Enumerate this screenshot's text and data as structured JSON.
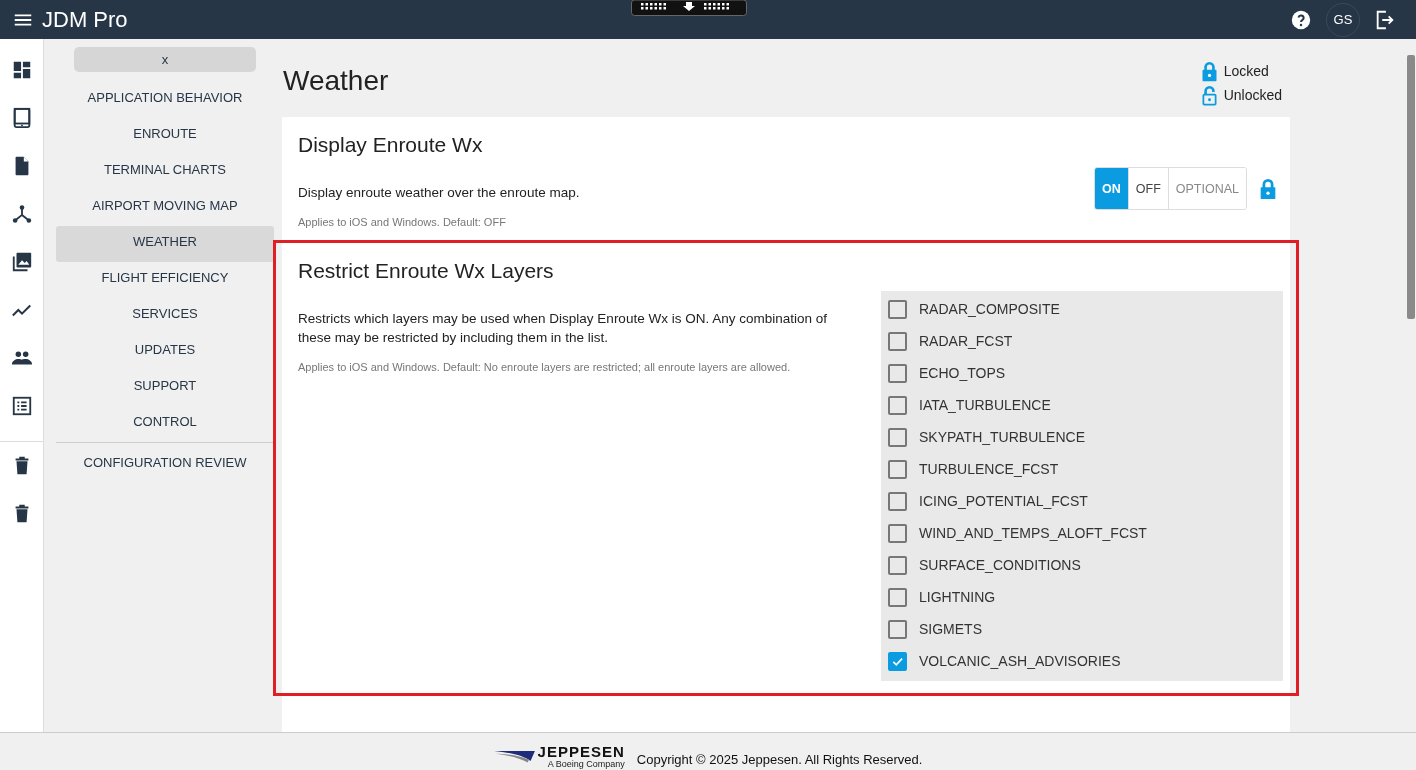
{
  "header": {
    "title": "JDM Pro",
    "avatar": "GS"
  },
  "nav": {
    "close_label": "x",
    "items": [
      {
        "label": "APPLICATION BEHAVIOR",
        "selected": false
      },
      {
        "label": "ENROUTE",
        "selected": false
      },
      {
        "label": "TERMINAL CHARTS",
        "selected": false
      },
      {
        "label": "AIRPORT MOVING MAP",
        "selected": false
      },
      {
        "label": "WEATHER",
        "selected": true
      },
      {
        "label": "FLIGHT EFFICIENCY",
        "selected": false
      },
      {
        "label": "SERVICES",
        "selected": false
      },
      {
        "label": "UPDATES",
        "selected": false
      },
      {
        "label": "SUPPORT",
        "selected": false
      },
      {
        "label": "CONTROL",
        "selected": false
      }
    ],
    "review_items": [
      {
        "label": "CONFIGURATION REVIEW",
        "selected": false
      }
    ]
  },
  "page": {
    "title": "Weather",
    "legend": [
      {
        "kind": "locked",
        "label": "Locked"
      },
      {
        "kind": "unlocked",
        "label": "Unlocked"
      }
    ]
  },
  "settings": [
    {
      "kind": "segmented",
      "highlighted": false,
      "locked": true,
      "title": "Display Enroute Wx",
      "description": "Display enroute weather over the enroute map.",
      "note": "Applies to iOS and Windows. Default: OFF",
      "options": [
        {
          "label": "ON",
          "selected": true
        },
        {
          "label": "OFF",
          "selected": false
        },
        {
          "label": "OPTIONAL",
          "selected": false
        }
      ]
    },
    {
      "kind": "checklist",
      "highlighted": true,
      "title": "Restrict Enroute Wx Layers",
      "description": "Restricts which layers may be used when Display Enroute Wx is ON. Any combination of these may be restricted by including them in the list.",
      "note": "Applies to iOS and Windows. Default: No enroute layers are restricted; all enroute layers are allowed.",
      "items": [
        {
          "label": "RADAR_COMPOSITE",
          "checked": false
        },
        {
          "label": "RADAR_FCST",
          "checked": false
        },
        {
          "label": "ECHO_TOPS",
          "checked": false
        },
        {
          "label": "IATA_TURBULENCE",
          "checked": false
        },
        {
          "label": "SKYPATH_TURBULENCE",
          "checked": false
        },
        {
          "label": "TURBULENCE_FCST",
          "checked": false
        },
        {
          "label": "ICING_POTENTIAL_FCST",
          "checked": false
        },
        {
          "label": "WIND_AND_TEMPS_ALOFT_FCST",
          "checked": false
        },
        {
          "label": "SURFACE_CONDITIONS",
          "checked": false
        },
        {
          "label": "LIGHTNING",
          "checked": false
        },
        {
          "label": "SIGMETS",
          "checked": false
        },
        {
          "label": "VOLCANIC_ASH_ADVISORIES",
          "checked": true
        }
      ]
    }
  ],
  "footer": {
    "brand": "JEPPESEN",
    "tagline": "A Boeing Company",
    "copyright": "Copyright © 2025 Jeppesen. All Rights Reserved."
  }
}
